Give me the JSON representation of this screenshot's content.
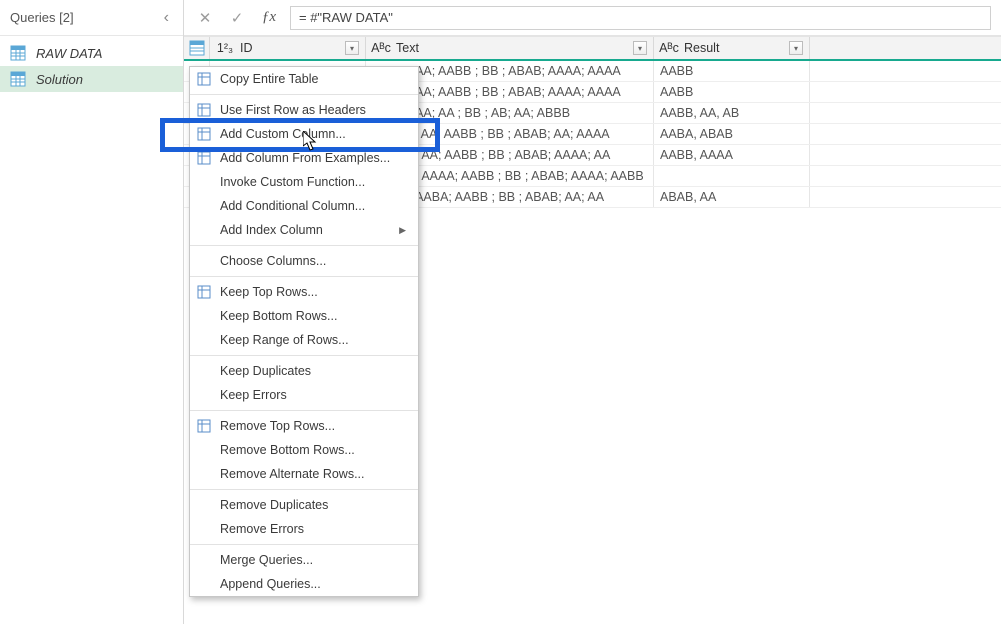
{
  "sidebar": {
    "title": "Queries [2]",
    "items": [
      {
        "label": "RAW DATA"
      },
      {
        "label": "Solution"
      }
    ]
  },
  "formula_bar": {
    "value": "= #\"RAW DATA\""
  },
  "columns": {
    "id": {
      "label": "ID",
      "type_label": "1²₃"
    },
    "text": {
      "label": "Text",
      "type_label": "Aᴮc"
    },
    "result": {
      "label": "Result",
      "type_label": "Aᴮc"
    }
  },
  "rows": [
    {
      "text": "AABB ; AA; AABB ; BB ; ABAB; AAAA; AAAA",
      "result": "AABB"
    },
    {
      "text": "AABB ; AA; AABB ; BB ; ABAB; AAAA; AAAA",
      "result": "AABB"
    },
    {
      "text": "AABB ; AA; AA ; BB ; AB; AA; ABBB",
      "result": "AABB, AA, AB"
    },
    {
      "text": "; AABA ; AA; AABB ; BB ; ABAB; AA; AAAA",
      "result": "AABA, ABAB"
    },
    {
      "text": "; AABB ; AA; AABB ; BB ; ABAB; AAAA; AA",
      "result": "AABB, AAAA"
    },
    {
      "text": "; AABB ; AAAA; AABB ; BB ; ABAB; AAAA; AABB",
      "result": ""
    },
    {
      "text": "AABB ; AABA; AABB ; BB ; ABAB; AA; AA",
      "result": "ABAB, AA"
    }
  ],
  "context_menu": {
    "groups": [
      [
        {
          "label": "Copy Entire Table",
          "icon": "copy-icon"
        }
      ],
      [
        {
          "label": "Use First Row as Headers",
          "icon": "headers-icon"
        },
        {
          "label": "Add Custom Column...",
          "icon": "custom-column-icon",
          "highlighted": true
        },
        {
          "label": "Add Column From Examples...",
          "icon": "examples-icon"
        },
        {
          "label": "Invoke Custom Function..."
        },
        {
          "label": "Add Conditional Column..."
        },
        {
          "label": "Add Index Column",
          "submenu": true
        }
      ],
      [
        {
          "label": "Choose Columns..."
        }
      ],
      [
        {
          "label": "Keep Top Rows...",
          "icon": "keep-rows-icon"
        },
        {
          "label": "Keep Bottom Rows..."
        },
        {
          "label": "Keep Range of Rows..."
        }
      ],
      [
        {
          "label": "Keep Duplicates"
        },
        {
          "label": "Keep Errors"
        }
      ],
      [
        {
          "label": "Remove Top Rows...",
          "icon": "remove-rows-icon"
        },
        {
          "label": "Remove Bottom Rows..."
        },
        {
          "label": "Remove Alternate Rows..."
        }
      ],
      [
        {
          "label": "Remove Duplicates"
        },
        {
          "label": "Remove Errors"
        }
      ],
      [
        {
          "label": "Merge Queries..."
        },
        {
          "label": "Append Queries..."
        }
      ]
    ]
  }
}
